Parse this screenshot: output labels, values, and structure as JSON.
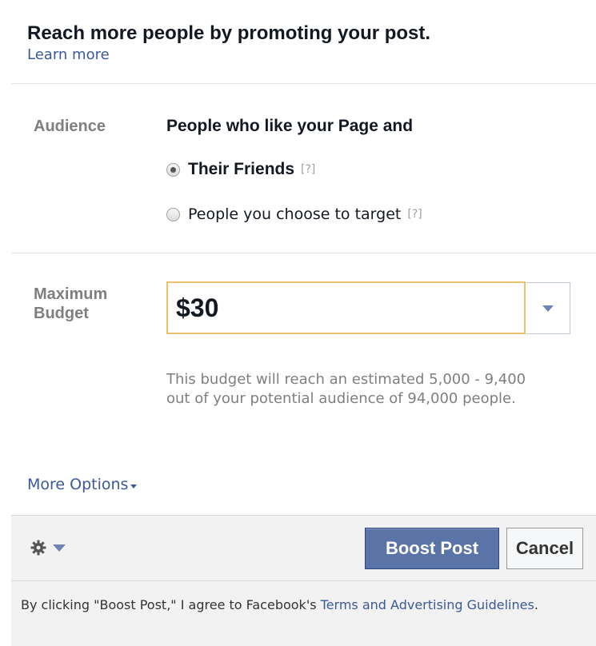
{
  "header": {
    "title": "Reach more people by promoting your post.",
    "learn_more": "Learn more"
  },
  "audience": {
    "label": "Audience",
    "heading": "People who like your Page and",
    "options": [
      {
        "label": "Their Friends",
        "help": "[?]",
        "selected": true
      },
      {
        "label": "People you choose to target",
        "help": "[?]",
        "selected": false
      }
    ]
  },
  "budget": {
    "label_line1": "Maximum",
    "label_line2": "Budget",
    "value": "$30",
    "estimate": "This budget will reach an estimated 5,000 - 9,400 out of your potential audience of 94,000 people."
  },
  "more_options": "More Options",
  "footer": {
    "gear_icon": "gear-icon",
    "boost_label": "Boost Post",
    "cancel_label": "Cancel",
    "legal_prefix": "By clicking \"Boost Post,\" I agree to Facebook's ",
    "legal_link": "Terms and Advertising Guidelines",
    "legal_suffix": "."
  },
  "colors": {
    "link": "#3b5998",
    "primary_button": "#5b74a8",
    "focus_border": "#e8c36a"
  }
}
